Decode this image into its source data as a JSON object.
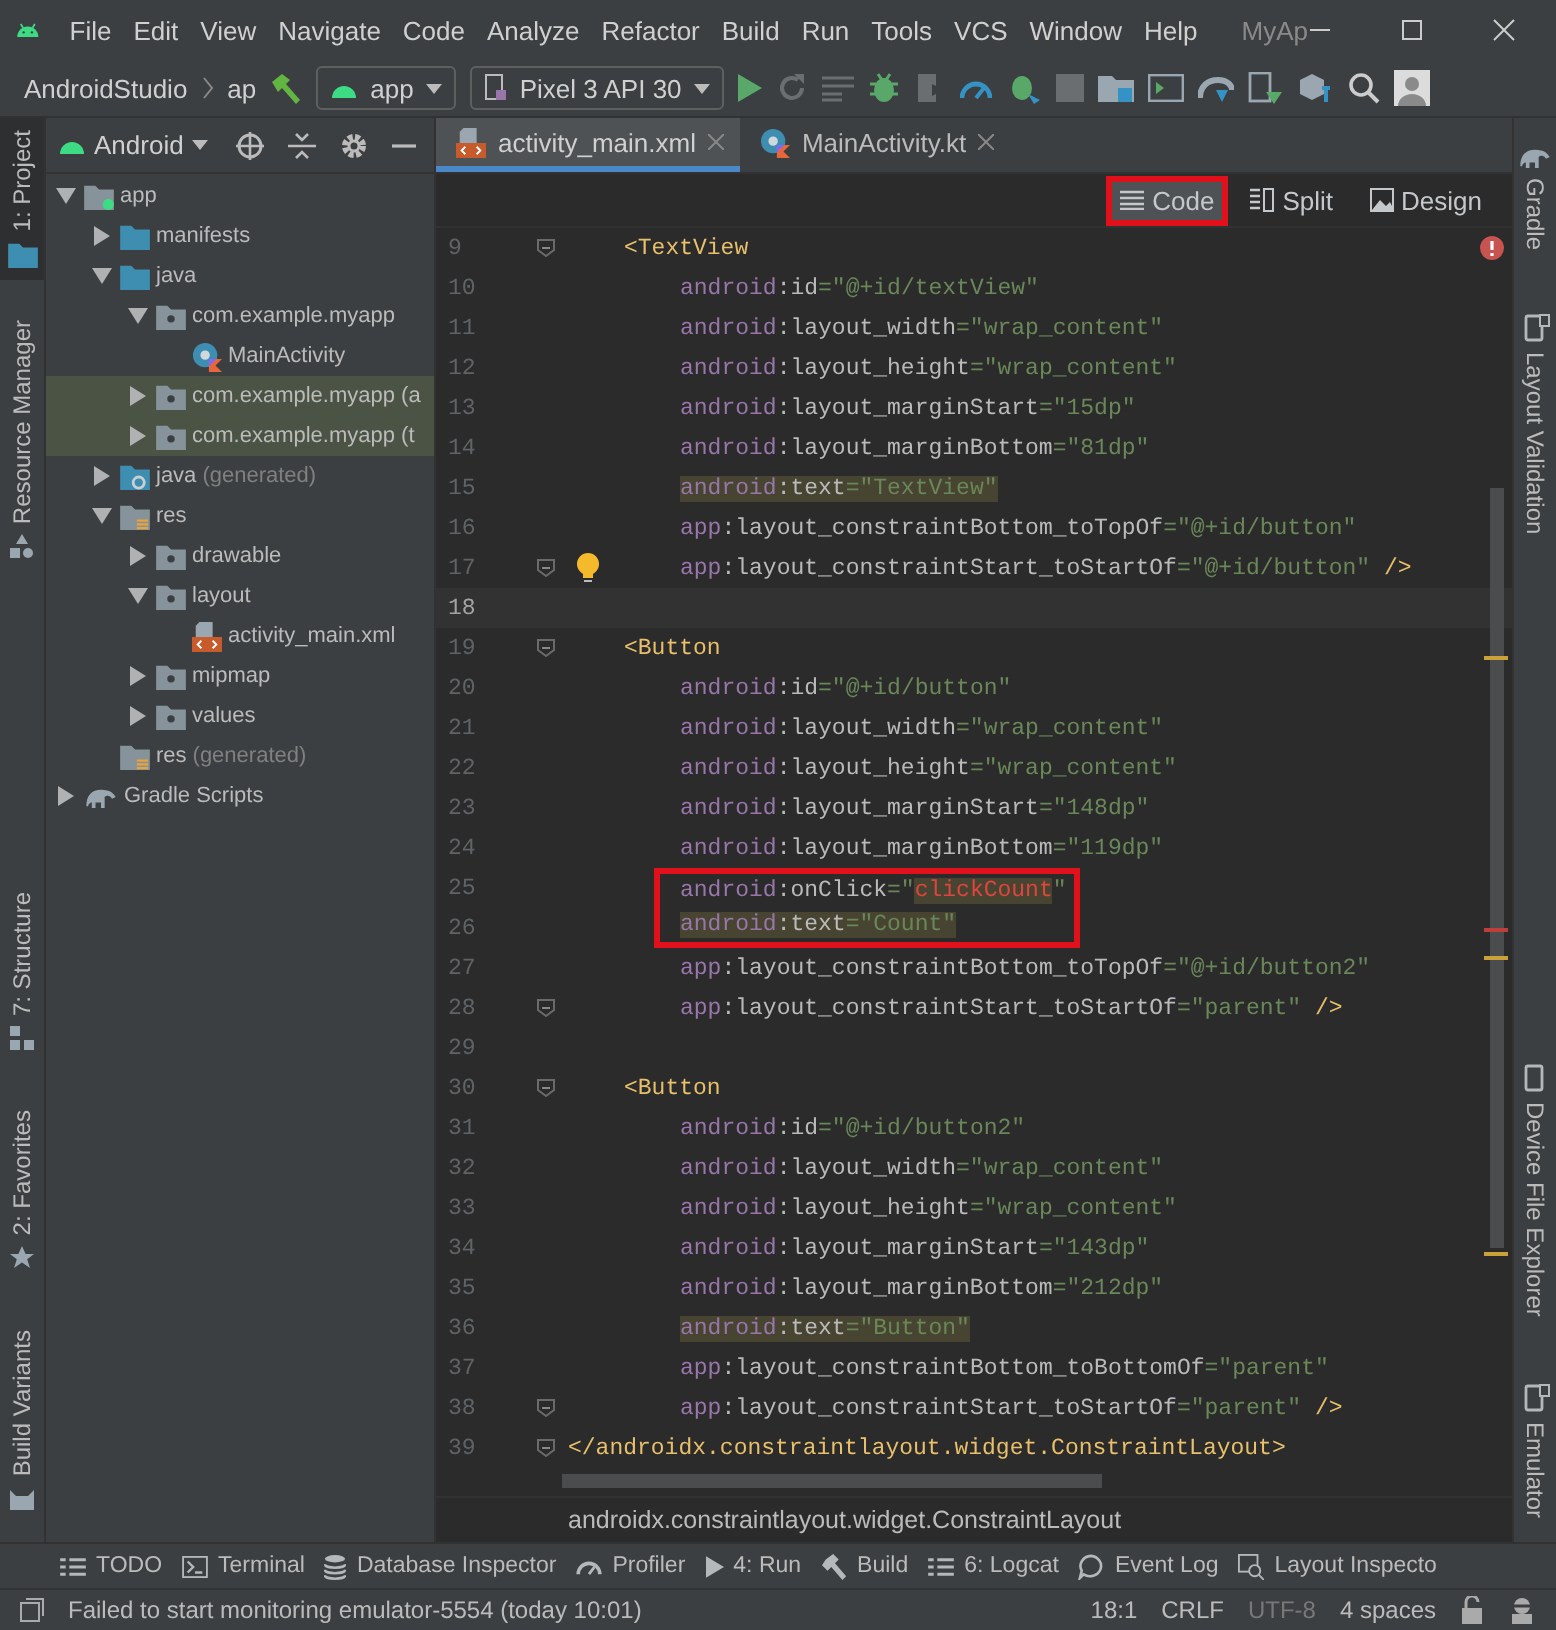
{
  "menu_bar": {
    "items": [
      "File",
      "Edit",
      "View",
      "Navigate",
      "Code",
      "Analyze",
      "Refactor",
      "Build",
      "Run",
      "Tools",
      "VCS",
      "Window",
      "Help"
    ],
    "title": "MyAp"
  },
  "toolbar": {
    "breadcrumb": [
      "AndroidStudio",
      "ap"
    ],
    "config": "app",
    "device": "Pixel 3 API 30"
  },
  "left_stripe": {
    "top": [
      {
        "label": "1: Project",
        "selected": true
      },
      {
        "label": "Resource Manager",
        "selected": false
      }
    ],
    "bottom": [
      {
        "label": "7: Structure",
        "selected": false
      },
      {
        "label": "2: Favorites",
        "selected": false
      },
      {
        "label": "Build Variants",
        "selected": false
      }
    ]
  },
  "project": {
    "view": "Android",
    "tree": [
      {
        "label": "app",
        "kind": "module",
        "expanded": true,
        "selected": false,
        "children": [
          {
            "label": "manifests",
            "kind": "folder",
            "expanded": false,
            "selected": false
          },
          {
            "label": "java",
            "kind": "folder",
            "expanded": true,
            "selected": false,
            "children": [
              {
                "label": "com.example.myapp",
                "kind": "package",
                "expanded": true,
                "selected": false,
                "children": [
                  {
                    "label": "MainActivity",
                    "kind": "kotlin",
                    "selected": false
                  }
                ]
              },
              {
                "label": "com.example.myapp (a",
                "kind": "package",
                "expanded": false,
                "selected": true
              },
              {
                "label": "com.example.myapp (t",
                "kind": "package",
                "expanded": false,
                "selected": true
              }
            ]
          },
          {
            "label": "java",
            "note": "(generated)",
            "kind": "generated",
            "expanded": false,
            "selected": false
          },
          {
            "label": "res",
            "kind": "res",
            "expanded": true,
            "selected": false,
            "children": [
              {
                "label": "drawable",
                "kind": "package",
                "expanded": false,
                "selected": false
              },
              {
                "label": "layout",
                "kind": "package",
                "expanded": true,
                "selected": false,
                "children": [
                  {
                    "label": "activity_main.xml",
                    "kind": "xml",
                    "selected": false
                  }
                ]
              },
              {
                "label": "mipmap",
                "kind": "package",
                "expanded": false,
                "selected": false
              },
              {
                "label": "values",
                "kind": "package",
                "expanded": false,
                "selected": false
              }
            ]
          },
          {
            "label": "res",
            "note": "(generated)",
            "kind": "res",
            "selected": false
          }
        ]
      },
      {
        "label": "Gradle Scripts",
        "kind": "gradle",
        "expanded": false,
        "selected": false
      }
    ]
  },
  "tabs": [
    {
      "label": "activity_main.xml",
      "kind": "xml",
      "selected": true
    },
    {
      "label": "MainActivity.kt",
      "kind": "kotlin",
      "selected": false
    }
  ],
  "view_modes": [
    {
      "label": "Code",
      "selected": true,
      "outlined": true
    },
    {
      "label": "Split",
      "selected": false,
      "outlined": false
    },
    {
      "label": "Design",
      "selected": false,
      "outlined": false
    }
  ],
  "code_lines": [
    {
      "n": "9",
      "kind": "open-tag",
      "fold": true,
      "hint": false,
      "current": false,
      "outlined": false,
      "tokens": [
        {
          "kind": "tag",
          "text": "<TextView",
          "highlighted": false
        }
      ]
    },
    {
      "n": "10",
      "kind": "attribute",
      "fold": false,
      "hint": false,
      "current": false,
      "outlined": false,
      "tokens": [
        {
          "kind": "ns",
          "text": "android",
          "highlighted": false
        },
        {
          "kind": "attr",
          "text": ":id",
          "highlighted": false
        },
        {
          "kind": "str",
          "text": "=\"@+id/textView\"",
          "highlighted": false
        }
      ]
    },
    {
      "n": "11",
      "kind": "attribute",
      "fold": false,
      "hint": false,
      "current": false,
      "outlined": false,
      "tokens": [
        {
          "kind": "ns",
          "text": "android",
          "highlighted": false
        },
        {
          "kind": "attr",
          "text": ":layout_width",
          "highlighted": false
        },
        {
          "kind": "str",
          "text": "=\"wrap_content\"",
          "highlighted": false
        }
      ]
    },
    {
      "n": "12",
      "kind": "attribute",
      "fold": false,
      "hint": false,
      "current": false,
      "outlined": false,
      "tokens": [
        {
          "kind": "ns",
          "text": "android",
          "highlighted": false
        },
        {
          "kind": "attr",
          "text": ":layout_height",
          "highlighted": false
        },
        {
          "kind": "str",
          "text": "=\"wrap_content\"",
          "highlighted": false
        }
      ]
    },
    {
      "n": "13",
      "kind": "attribute",
      "fold": false,
      "hint": false,
      "current": false,
      "outlined": false,
      "tokens": [
        {
          "kind": "ns",
          "text": "android",
          "highlighted": false
        },
        {
          "kind": "attr",
          "text": ":layout_marginStart",
          "highlighted": false
        },
        {
          "kind": "str",
          "text": "=\"15dp\"",
          "highlighted": false
        }
      ]
    },
    {
      "n": "14",
      "kind": "attribute",
      "fold": false,
      "hint": false,
      "current": false,
      "outlined": false,
      "tokens": [
        {
          "kind": "ns",
          "text": "android",
          "highlighted": false
        },
        {
          "kind": "attr",
          "text": ":layout_marginBottom",
          "highlighted": false
        },
        {
          "kind": "str",
          "text": "=\"81dp\"",
          "highlighted": false
        }
      ]
    },
    {
      "n": "15",
      "kind": "attribute",
      "fold": false,
      "hint": false,
      "current": false,
      "outlined": false,
      "tokens": [
        {
          "kind": "ns",
          "text": "android",
          "highlighted": true
        },
        {
          "kind": "attr",
          "text": ":text",
          "highlighted": true
        },
        {
          "kind": "str",
          "text": "=\"TextView\"",
          "highlighted": true
        }
      ]
    },
    {
      "n": "16",
      "kind": "attribute",
      "fold": false,
      "hint": false,
      "current": false,
      "outlined": false,
      "tokens": [
        {
          "kind": "ns",
          "text": "app",
          "highlighted": false
        },
        {
          "kind": "attr",
          "text": ":layout_constraintBottom_toTopOf",
          "highlighted": false
        },
        {
          "kind": "str",
          "text": "=\"@+id/button\"",
          "highlighted": false
        }
      ]
    },
    {
      "n": "17",
      "kind": "attribute",
      "fold": true,
      "hint": true,
      "current": false,
      "outlined": false,
      "tokens": [
        {
          "kind": "ns",
          "text": "app",
          "highlighted": false
        },
        {
          "kind": "attr",
          "text": ":layout_constraintStart_toStartOf",
          "highlighted": false
        },
        {
          "kind": "str",
          "text": "=\"@+id/button\"",
          "highlighted": false
        },
        {
          "kind": "close",
          "text": "/>",
          "highlighted": false
        }
      ]
    },
    {
      "n": "18",
      "fold": false,
      "hint": false,
      "current": true,
      "outlined": false
    },
    {
      "n": "19",
      "kind": "open-tag",
      "fold": true,
      "hint": false,
      "current": false,
      "outlined": false,
      "tokens": [
        {
          "kind": "tag",
          "text": "<Button",
          "highlighted": false
        }
      ]
    },
    {
      "n": "20",
      "kind": "attribute",
      "fold": false,
      "hint": false,
      "current": false,
      "outlined": false,
      "tokens": [
        {
          "kind": "ns",
          "text": "android",
          "highlighted": false
        },
        {
          "kind": "attr",
          "text": ":id",
          "highlighted": false
        },
        {
          "kind": "str",
          "text": "=\"@+id/button\"",
          "highlighted": false
        }
      ]
    },
    {
      "n": "21",
      "kind": "attribute",
      "fold": false,
      "hint": false,
      "current": false,
      "outlined": false,
      "tokens": [
        {
          "kind": "ns",
          "text": "android",
          "highlighted": false
        },
        {
          "kind": "attr",
          "text": ":layout_width",
          "highlighted": false
        },
        {
          "kind": "str",
          "text": "=\"wrap_content\"",
          "highlighted": false
        }
      ]
    },
    {
      "n": "22",
      "kind": "attribute",
      "fold": false,
      "hint": false,
      "current": false,
      "outlined": false,
      "tokens": [
        {
          "kind": "ns",
          "text": "android",
          "highlighted": false
        },
        {
          "kind": "attr",
          "text": ":layout_height",
          "highlighted": false
        },
        {
          "kind": "str",
          "text": "=\"wrap_content\"",
          "highlighted": false
        }
      ]
    },
    {
      "n": "23",
      "kind": "attribute",
      "fold": false,
      "hint": false,
      "current": false,
      "outlined": false,
      "tokens": [
        {
          "kind": "ns",
          "text": "android",
          "highlighted": false
        },
        {
          "kind": "attr",
          "text": ":layout_marginStart",
          "highlighted": false
        },
        {
          "kind": "str",
          "text": "=\"148dp\"",
          "highlighted": false
        }
      ]
    },
    {
      "n": "24",
      "kind": "attribute",
      "fold": false,
      "hint": false,
      "current": false,
      "outlined": false,
      "tokens": [
        {
          "kind": "ns",
          "text": "android",
          "highlighted": false
        },
        {
          "kind": "attr",
          "text": ":layout_marginBottom",
          "highlighted": false
        },
        {
          "kind": "str",
          "text": "=\"119dp\"",
          "highlighted": false
        }
      ]
    },
    {
      "n": "25",
      "kind": "attribute",
      "fold": false,
      "hint": false,
      "current": false,
      "outlined": true,
      "tokens": [
        {
          "kind": "ns",
          "text": "android",
          "highlighted": false
        },
        {
          "kind": "attr",
          "text": ":onClick",
          "highlighted": false
        },
        {
          "kind": "str",
          "text": "=\"",
          "highlighted": false
        },
        {
          "kind": "err",
          "text": "clickCount",
          "highlighted": true
        },
        {
          "kind": "str",
          "text": "\"",
          "highlighted": false
        }
      ]
    },
    {
      "n": "26",
      "kind": "attribute",
      "fold": false,
      "hint": false,
      "current": false,
      "outlined": true,
      "tokens": [
        {
          "kind": "ns",
          "text": "android",
          "highlighted": true
        },
        {
          "kind": "attr",
          "text": ":text",
          "highlighted": true
        },
        {
          "kind": "str",
          "text": "=\"Count\"",
          "highlighted": true
        }
      ]
    },
    {
      "n": "27",
      "kind": "attribute",
      "fold": false,
      "hint": false,
      "current": false,
      "outlined": false,
      "tokens": [
        {
          "kind": "ns",
          "text": "app",
          "highlighted": false
        },
        {
          "kind": "attr",
          "text": ":layout_constraintBottom_toTopOf",
          "highlighted": false
        },
        {
          "kind": "str",
          "text": "=\"@+id/button2\"",
          "highlighted": false
        }
      ]
    },
    {
      "n": "28",
      "kind": "attribute",
      "fold": true,
      "hint": false,
      "current": false,
      "outlined": false,
      "tokens": [
        {
          "kind": "ns",
          "text": "app",
          "highlighted": false
        },
        {
          "kind": "attr",
          "text": ":layout_constraintStart_toStartOf",
          "highlighted": false
        },
        {
          "kind": "str",
          "text": "=\"parent\"",
          "highlighted": false
        },
        {
          "kind": "close",
          "text": "/>",
          "highlighted": false
        }
      ]
    },
    {
      "n": "29",
      "fold": false,
      "hint": false,
      "current": false,
      "outlined": false
    },
    {
      "n": "30",
      "kind": "open-tag",
      "fold": true,
      "hint": false,
      "current": false,
      "outlined": false,
      "tokens": [
        {
          "kind": "tag",
          "text": "<Button",
          "highlighted": false
        }
      ]
    },
    {
      "n": "31",
      "kind": "attribute",
      "fold": false,
      "hint": false,
      "current": false,
      "outlined": false,
      "tokens": [
        {
          "kind": "ns",
          "text": "android",
          "highlighted": false
        },
        {
          "kind": "attr",
          "text": ":id",
          "highlighted": false
        },
        {
          "kind": "str",
          "text": "=\"@+id/button2\"",
          "highlighted": false
        }
      ]
    },
    {
      "n": "32",
      "kind": "attribute",
      "fold": false,
      "hint": false,
      "current": false,
      "outlined": false,
      "tokens": [
        {
          "kind": "ns",
          "text": "android",
          "highlighted": false
        },
        {
          "kind": "attr",
          "text": ":layout_width",
          "highlighted": false
        },
        {
          "kind": "str",
          "text": "=\"wrap_content\"",
          "highlighted": false
        }
      ]
    },
    {
      "n": "33",
      "kind": "attribute",
      "fold": false,
      "hint": false,
      "current": false,
      "outlined": false,
      "tokens": [
        {
          "kind": "ns",
          "text": "android",
          "highlighted": false
        },
        {
          "kind": "attr",
          "text": ":layout_height",
          "highlighted": false
        },
        {
          "kind": "str",
          "text": "=\"wrap_content\"",
          "highlighted": false
        }
      ]
    },
    {
      "n": "34",
      "kind": "attribute",
      "fold": false,
      "hint": false,
      "current": false,
      "outlined": false,
      "tokens": [
        {
          "kind": "ns",
          "text": "android",
          "highlighted": false
        },
        {
          "kind": "attr",
          "text": ":layout_marginStart",
          "highlighted": false
        },
        {
          "kind": "str",
          "text": "=\"143dp\"",
          "highlighted": false
        }
      ]
    },
    {
      "n": "35",
      "kind": "attribute",
      "fold": false,
      "hint": false,
      "current": false,
      "outlined": false,
      "tokens": [
        {
          "kind": "ns",
          "text": "android",
          "highlighted": false
        },
        {
          "kind": "attr",
          "text": ":layout_marginBottom",
          "highlighted": false
        },
        {
          "kind": "str",
          "text": "=\"212dp\"",
          "highlighted": false
        }
      ]
    },
    {
      "n": "36",
      "kind": "attribute",
      "fold": false,
      "hint": false,
      "current": false,
      "outlined": false,
      "tokens": [
        {
          "kind": "ns",
          "text": "android",
          "highlighted": true
        },
        {
          "kind": "attr",
          "text": ":text",
          "highlighted": true
        },
        {
          "kind": "str",
          "text": "=\"Button\"",
          "highlighted": true
        }
      ]
    },
    {
      "n": "37",
      "kind": "attribute",
      "fold": false,
      "hint": false,
      "current": false,
      "outlined": false,
      "tokens": [
        {
          "kind": "ns",
          "text": "app",
          "highlighted": false
        },
        {
          "kind": "attr",
          "text": ":layout_constraintBottom_toBottomOf",
          "highlighted": false
        },
        {
          "kind": "str",
          "text": "=\"parent\"",
          "highlighted": false
        }
      ]
    },
    {
      "n": "38",
      "kind": "attribute",
      "fold": true,
      "hint": false,
      "current": false,
      "outlined": false,
      "tokens": [
        {
          "kind": "ns",
          "text": "app",
          "highlighted": false
        },
        {
          "kind": "attr",
          "text": ":layout_constraintStart_toStartOf",
          "highlighted": false
        },
        {
          "kind": "str",
          "text": "=\"parent\"",
          "highlighted": false
        },
        {
          "kind": "close",
          "text": "/>",
          "highlighted": false
        }
      ]
    },
    {
      "n": "39",
      "kind": "close-tag",
      "fold": true,
      "hint": false,
      "current": false,
      "outlined": false,
      "tokens": [
        {
          "kind": "tag",
          "text": "</androidx.constraintlayout.widget.ConstraintLayout>",
          "highlighted": false
        }
      ]
    }
  ],
  "breadcrumb": "androidx.constraintlayout.widget.ConstraintLayout",
  "right_stripe": {
    "top": [
      "Gradle",
      "Layout Validation"
    ],
    "bottom": [
      "Device File Explorer",
      "Emulator"
    ]
  },
  "tool_windows": [
    "TODO",
    "Terminal",
    "Database Inspector",
    "Profiler",
    "4: Run",
    "Build",
    "6: Logcat",
    "Event Log",
    "Layout Inspecto"
  ],
  "status_bar": {
    "message": "Failed to start monitoring emulator-5554 (today 10:01)",
    "position": "18:1",
    "line_separator": "CRLF",
    "encoding": "UTF-8",
    "indent": "4 spaces"
  }
}
